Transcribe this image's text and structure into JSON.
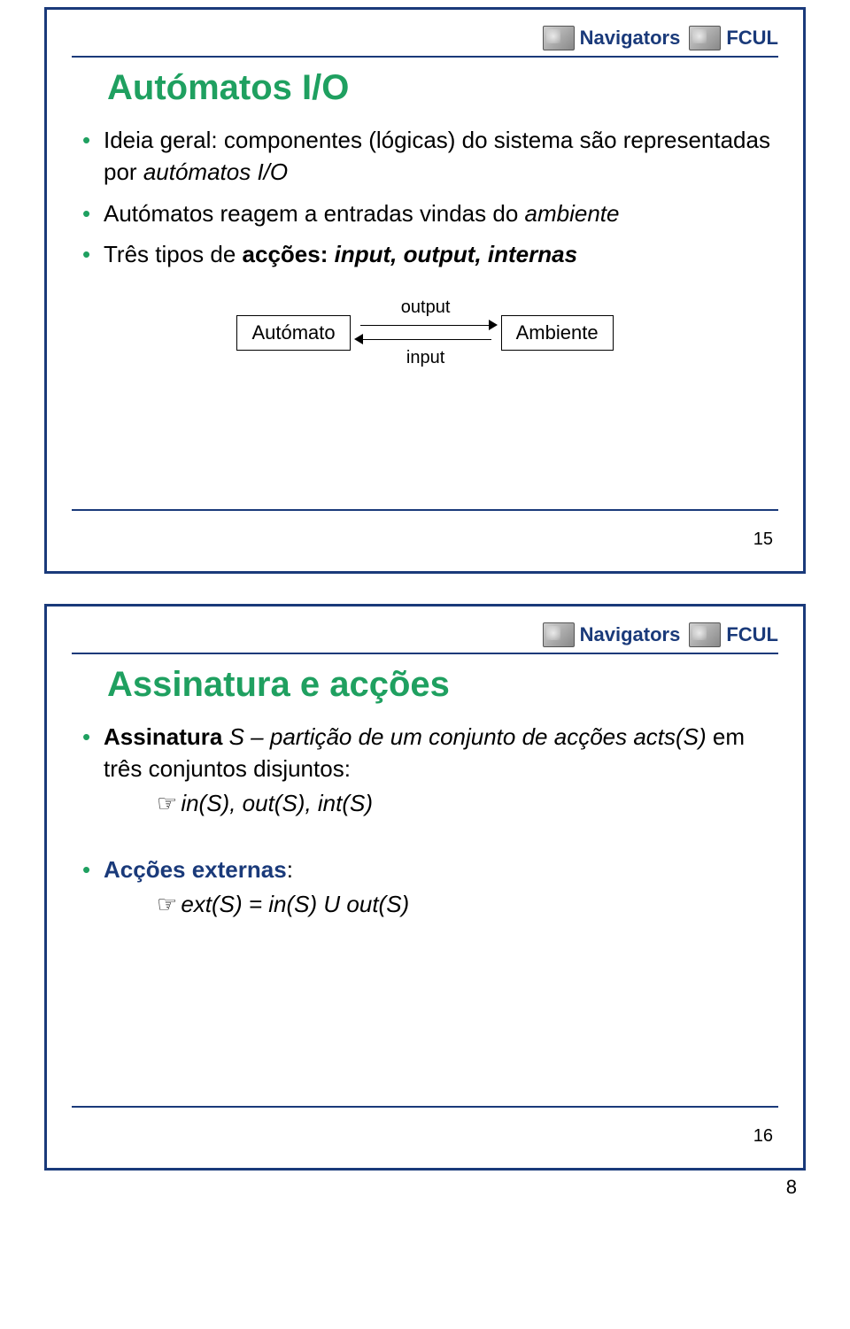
{
  "branding": {
    "navigators": "Navigators",
    "fcul": "FCUL"
  },
  "slide1": {
    "title": "Autómatos I/O",
    "b1_pre": "Ideia geral: componentes (lógicas) do sistema são representadas por ",
    "b1_em": "autómatos I/O",
    "b2_pre": "Autómatos reagem a entradas vindas do ",
    "b2_em": "ambiente",
    "b3_pre": "Três tipos de ",
    "b3_bold": "acções: ",
    "b3_em": "input, output, internas",
    "diagram": {
      "left": "Autómato",
      "right": "Ambiente",
      "top": "output",
      "bottom": "input"
    },
    "num": "15"
  },
  "slide2": {
    "title": "Assinatura e acções",
    "b1_bold": "Assinatura",
    "b1_mid": "  S – partição de um conjunto de acções  ",
    "b1_em": "acts(S)",
    "b1_tail": "  em três conjuntos disjuntos:",
    "sub1": "in(S),  out(S),  int(S)",
    "b2_pre": "Acções externas",
    "b2_tail": ":",
    "sub2": "ext(S) = in(S) U out(S)",
    "num": "16"
  },
  "footer": {
    "page": "8"
  }
}
